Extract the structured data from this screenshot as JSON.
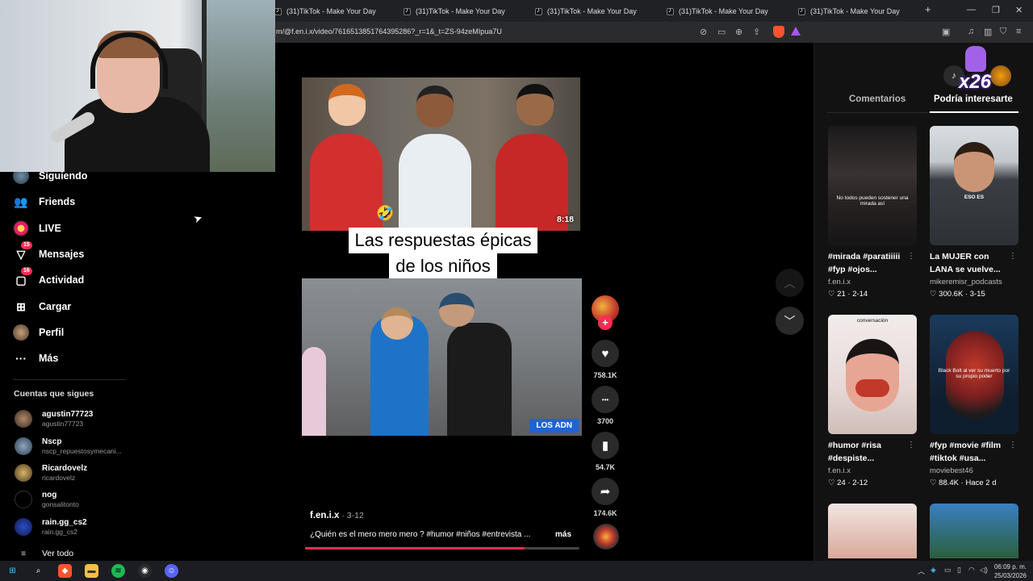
{
  "browser": {
    "tabs": [
      {
        "label": "(31)TikTok - Make Your Day"
      },
      {
        "label": "(31)TikTok - Make Your Day"
      },
      {
        "label": "(31)TikTok - Make Your Day"
      },
      {
        "label": "(31)TikTok - Make Your Day"
      },
      {
        "label": "(31)TikTok - Make Your Day"
      }
    ],
    "new_tab": "+",
    "url": "m/@f.en.i.x/video/7616513851764395286?_r=1&_t=ZS-94zeMIpua7U",
    "win_min": "—",
    "win_max": "❐",
    "win_close": "✕"
  },
  "sidebar": {
    "items": [
      {
        "label": "Siguiendo",
        "icon": "following-avatar-icon"
      },
      {
        "label": "Friends",
        "icon": "friends-icon",
        "glyph": "👥"
      },
      {
        "label": "LIVE",
        "icon": "live-icon"
      },
      {
        "label": "Mensajes",
        "icon": "messages-icon",
        "glyph": "▽",
        "badge": "15"
      },
      {
        "label": "Actividad",
        "icon": "activity-icon",
        "glyph": "▢",
        "badge": "16"
      },
      {
        "label": "Cargar",
        "icon": "upload-icon",
        "glyph": "⊞"
      },
      {
        "label": "Perfil",
        "icon": "profile-avatar-icon"
      },
      {
        "label": "Más",
        "icon": "more-icon",
        "glyph": "···"
      }
    ],
    "following_header": "Cuentas que sigues",
    "following": [
      {
        "name": "agustin77723",
        "handle": "agustin77723"
      },
      {
        "name": "Nscp",
        "handle": "nscp_repuestosymecani..."
      },
      {
        "name": "Ricardovelz",
        "handle": "ricardovelz"
      },
      {
        "name": "nog",
        "handle": "gonsalitonto"
      },
      {
        "name": "rain.gg_cs2",
        "handle": "rain.gg_cs2"
      }
    ],
    "see_all": "Ver todo"
  },
  "video": {
    "duration": "8:18",
    "emoji": "🤣",
    "caption_line1": "Las respuestas épicas",
    "caption_line2": "de los niños",
    "watermark": "LOS ADN",
    "author": "f.en.i.x",
    "date": "3-12",
    "separator": " · ",
    "description": "¿Quién es el mero mero mero ? #humor #niños #entrevista ...",
    "more": "más",
    "progress": 0.8
  },
  "actions": {
    "likes": "758.1K",
    "comments": "3700",
    "saves": "54.7K",
    "shares": "174.6K",
    "like_glyph": "♥",
    "comment_glyph": "•••",
    "save_glyph": "▮",
    "share_glyph": "➦",
    "follow_glyph": "+"
  },
  "navigation": {
    "up": "︿",
    "down": "﹀"
  },
  "right_panel": {
    "gift_count": "x26",
    "tabs": [
      "Comentarios",
      "Podría interesarte"
    ],
    "active_tab": 1,
    "cards": [
      {
        "title": "#mirada #paratiiiii #fyp #ojos...",
        "author": "f.en.i.x",
        "likes": "21",
        "date": "2-14",
        "thumb_text": "No todos pueden sostener una mirada así"
      },
      {
        "title": "La MUJER con LANA se vuelve...",
        "author": "mikeremisr_podcasts",
        "likes": "300.6K",
        "date": "3-15",
        "thumb_text": "ESO ES"
      },
      {
        "title": "#humor #risa #despiste...",
        "author": "f.en.i.x",
        "likes": "24",
        "date": "2-12",
        "thumb_text": "conversación"
      },
      {
        "title": "#fyp #movie #film #tiktok #usa...",
        "author": "moviebest46",
        "likes": "88.4K",
        "date": "Hace 2 d",
        "thumb_text": "Black Bolt al ver su muerto por su propio poder"
      }
    ]
  },
  "taskbar": {
    "time": "06:09 p. m.",
    "date": "25/03/2026"
  },
  "colors": {
    "accent": "#fe2c55",
    "background": "#000000",
    "panel": "#121212"
  }
}
